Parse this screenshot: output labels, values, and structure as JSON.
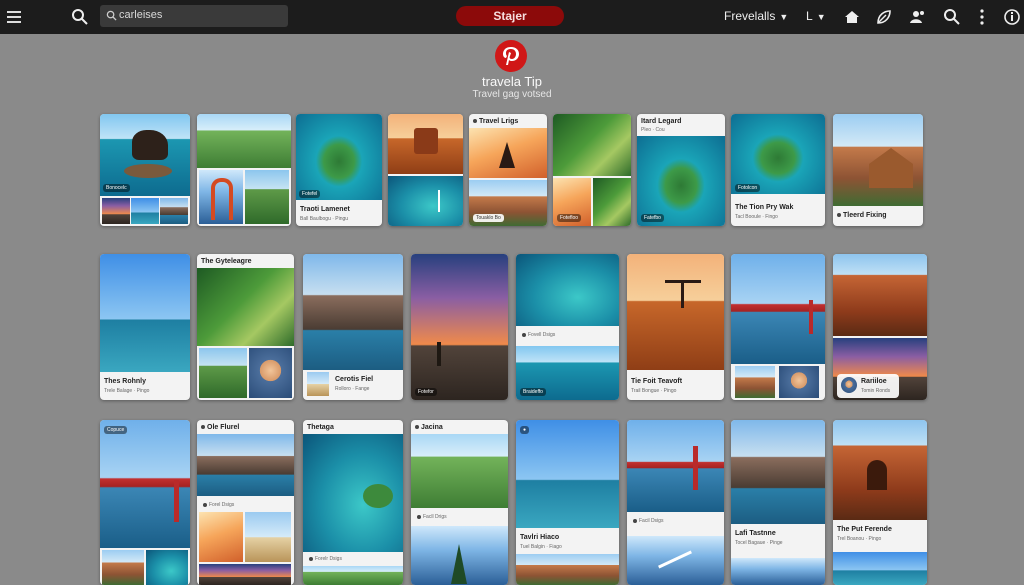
{
  "topbar": {
    "search_text": "carleises",
    "pill_label": "Stajer",
    "nav_label": "Frevelalls",
    "nav_small": "L"
  },
  "header": {
    "brand": "travela Tip",
    "tagline": "Travel gag votsed"
  },
  "colors": {
    "brand_red": "#d01717",
    "pill_red": "#8c0a0a",
    "bar": "#1c1c1c",
    "background": "#8a8a8a"
  },
  "pins": {
    "r1c1": {
      "chip": "Bonocelc"
    },
    "r1c3": {
      "chip": "Fotefel",
      "title": "Traoti Lamenet",
      "sub": "Ball Baulbogu · Pingu"
    },
    "r1c5": {
      "title": "Travel Lrigs",
      "chip": "Touaklo Bo"
    },
    "r1c6": {
      "chip": "Fotefloo"
    },
    "r1c7": {
      "title": "Itard Legard",
      "sub": "Pleo · Cou",
      "chip": "Fatefbo"
    },
    "r1c8": {
      "chip": "Fotolcon",
      "title": "The Tion Pry Wak",
      "sub": "Tacl Booule · Fingo"
    },
    "r1c9": {
      "title": "Tleerd Fixing"
    },
    "r2c1": {
      "title": "Thes Rohnly",
      "sub": "Trele Balage · Pingo"
    },
    "r2c2": {
      "title": "The Gyteleagre"
    },
    "r2c3": {
      "title": "Cerotis Fiel",
      "sub": "Rolloro · Fange"
    },
    "r2c4": {
      "chip": "Fotefor"
    },
    "r2c5": {
      "sub": "Fovell Dsigs",
      "chip": "Braideffo"
    },
    "r2c6": {
      "title": "Tie Foit Teavoft",
      "sub": "Trail Bongue · Pingo"
    },
    "r2c8": {
      "title": "Rariiloe",
      "sub": "Tomin Ronds"
    },
    "r3c1": {
      "chip": "Copuce"
    },
    "r3c2": {
      "title": "Ole Flurel",
      "sub": "Forel Dsigs"
    },
    "r3c3": {
      "title": "Thetaga",
      "sub": "Forelr Dsigs"
    },
    "r3c4": {
      "title": "Jacina",
      "sub": "Facll Drigs"
    },
    "r3c5": {
      "title": "Tavlri Hiaco",
      "sub": "Tuel Balgin · Fiago"
    },
    "r3c6": {
      "sub": "Facil Dsigs"
    },
    "r3c7": {
      "title": "Lafi Tastnne",
      "sub": "Tocel Bagaue · Pinge"
    },
    "r3c8": {
      "title": "The Put Ferende",
      "sub": "Trel Boanou · Pingo"
    }
  }
}
